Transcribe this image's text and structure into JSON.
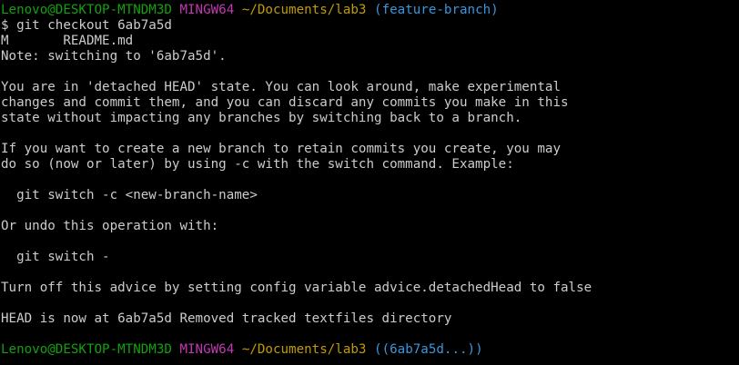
{
  "colors": {
    "background": "#000000",
    "text": "#cccccc",
    "user_host": "#13a10e",
    "system": "#c239b3",
    "path": "#c19c00",
    "branch": "#3a96dd"
  },
  "prompt1": {
    "user_host": "Lenovo@DESKTOP-MTNDM3D",
    "system": "MINGW64",
    "path": "~/Documents/lab3",
    "branch": "(feature-branch)"
  },
  "command": "$ git checkout 6ab7a5d",
  "output": {
    "modified_line": "M       README.md",
    "note": "Note: switching to '6ab7a5d'.",
    "detached_1": "You are in 'detached HEAD' state. You can look around, make experimental",
    "detached_2": "changes and commit them, and you can discard any commits you make in this",
    "detached_3": "state without impacting any branches by switching back to a branch.",
    "new_branch_1": "If you want to create a new branch to retain commits you create, you may",
    "new_branch_2": "do so (now or later) by using -c with the switch command. Example:",
    "example_cmd": "  git switch -c <new-branch-name>",
    "undo_intro": "Or undo this operation with:",
    "undo_cmd": "  git switch -",
    "advice_off": "Turn off this advice by setting config variable advice.detachedHead to false",
    "head_now": "HEAD is now at 6ab7a5d Removed tracked textfiles directory"
  },
  "prompt2": {
    "user_host": "Lenovo@DESKTOP-MTNDM3D",
    "system": "MINGW64",
    "path": "~/Documents/lab3",
    "branch": "((6ab7a5d...))"
  }
}
